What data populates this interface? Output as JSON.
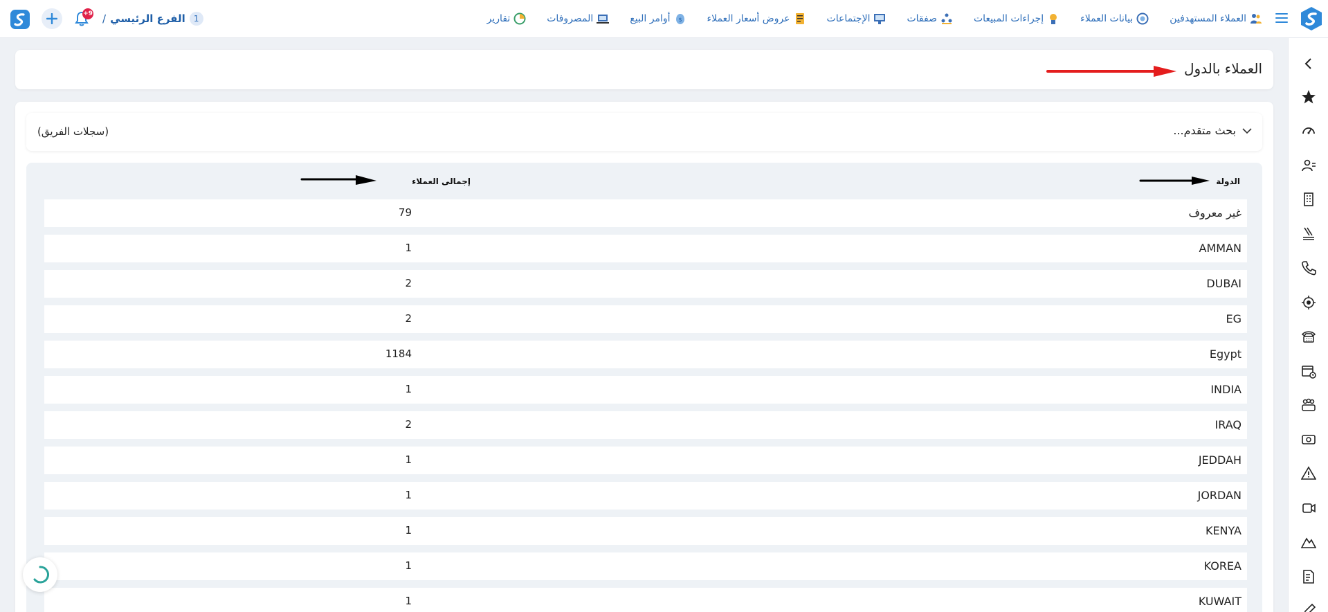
{
  "nav": {
    "items": [
      {
        "label": "العملاء المستهدفين",
        "icon": "users-target-icon"
      },
      {
        "label": "بيانات العملاء",
        "icon": "customer-data-icon"
      },
      {
        "label": "إجراءات المبيعات",
        "icon": "sales-actions-icon"
      },
      {
        "label": "صفقات",
        "icon": "deals-icon"
      },
      {
        "label": "الإجتماعات",
        "icon": "meetings-icon"
      },
      {
        "label": "عروض أسعار العملاء",
        "icon": "quotes-icon"
      },
      {
        "label": "أوامر البيع",
        "icon": "sales-orders-icon"
      },
      {
        "label": "المصروفات",
        "icon": "expenses-icon"
      },
      {
        "label": "تقارير",
        "icon": "reports-icon"
      }
    ]
  },
  "branch": {
    "number": "1",
    "name": "الفرع الرئيسي",
    "separator": "/"
  },
  "notifications": {
    "badge": "+9"
  },
  "page": {
    "title": "العملاء بالدول"
  },
  "search": {
    "advanced_label": "بحث متقدم...",
    "team_records_label": "(سجلات الفريق)"
  },
  "table": {
    "headers": {
      "country": "الدولة",
      "total": "إجمالى العملاء"
    },
    "rows": [
      {
        "country": "غير معروف",
        "total": "79"
      },
      {
        "country": "AMMAN",
        "total": "1"
      },
      {
        "country": "DUBAI",
        "total": "2"
      },
      {
        "country": "EG",
        "total": "2"
      },
      {
        "country": "Egypt",
        "total": "1184"
      },
      {
        "country": "INDIA",
        "total": "1"
      },
      {
        "country": "IRAQ",
        "total": "2"
      },
      {
        "country": "JEDDAH",
        "total": "1"
      },
      {
        "country": "JORDAN",
        "total": "1"
      },
      {
        "country": "KENYA",
        "total": "1"
      },
      {
        "country": "KOREA",
        "total": "1"
      },
      {
        "country": "KUWAIT",
        "total": "1"
      }
    ]
  },
  "sidebar": {
    "icons": [
      "chevron-left-icon",
      "star-icon",
      "dashboard-icon",
      "contacts-icon",
      "building-icon",
      "ticket-icon",
      "phone-icon",
      "target-icon",
      "telephone-icon",
      "calendar-icon",
      "team-icon",
      "money-icon",
      "warning-icon",
      "video-icon",
      "mountain-icon",
      "invoice-icon",
      "pen-icon"
    ]
  },
  "colors": {
    "accent": "#2f6fba",
    "badge": "#e0224a",
    "arrow_red": "#e41d1d",
    "arrow_black": "#000000"
  }
}
